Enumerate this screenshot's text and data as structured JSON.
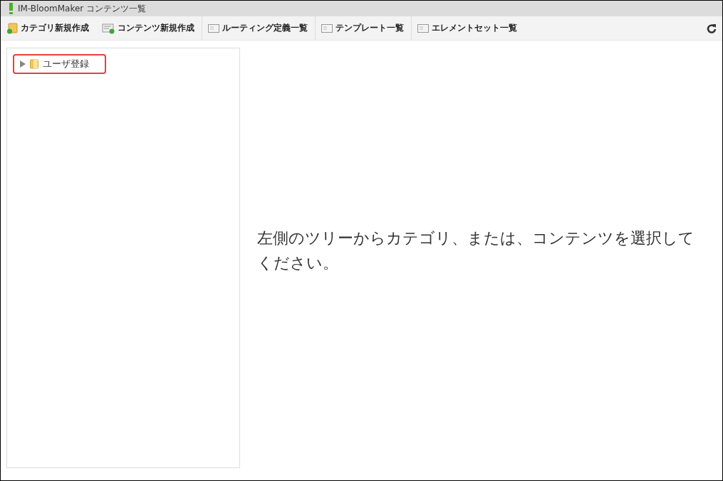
{
  "window": {
    "title": "IM-BloomMaker コンテンツ一覧"
  },
  "toolbar": {
    "items": [
      {
        "label": "カテゴリ新規作成",
        "kind": "folder-add"
      },
      {
        "label": "コンテンツ新規作成",
        "kind": "content-add"
      },
      {
        "label": "ルーティング定義一覧",
        "kind": "list"
      },
      {
        "label": "テンプレート一覧",
        "kind": "list"
      },
      {
        "label": "エレメントセット一覧",
        "kind": "list"
      }
    ]
  },
  "tree": {
    "items": [
      {
        "label": "ユーザ登録",
        "expanded": false,
        "highlighted": true
      }
    ]
  },
  "message": "左側のツリーからカテゴリ、または、コンテンツを選択してください。"
}
